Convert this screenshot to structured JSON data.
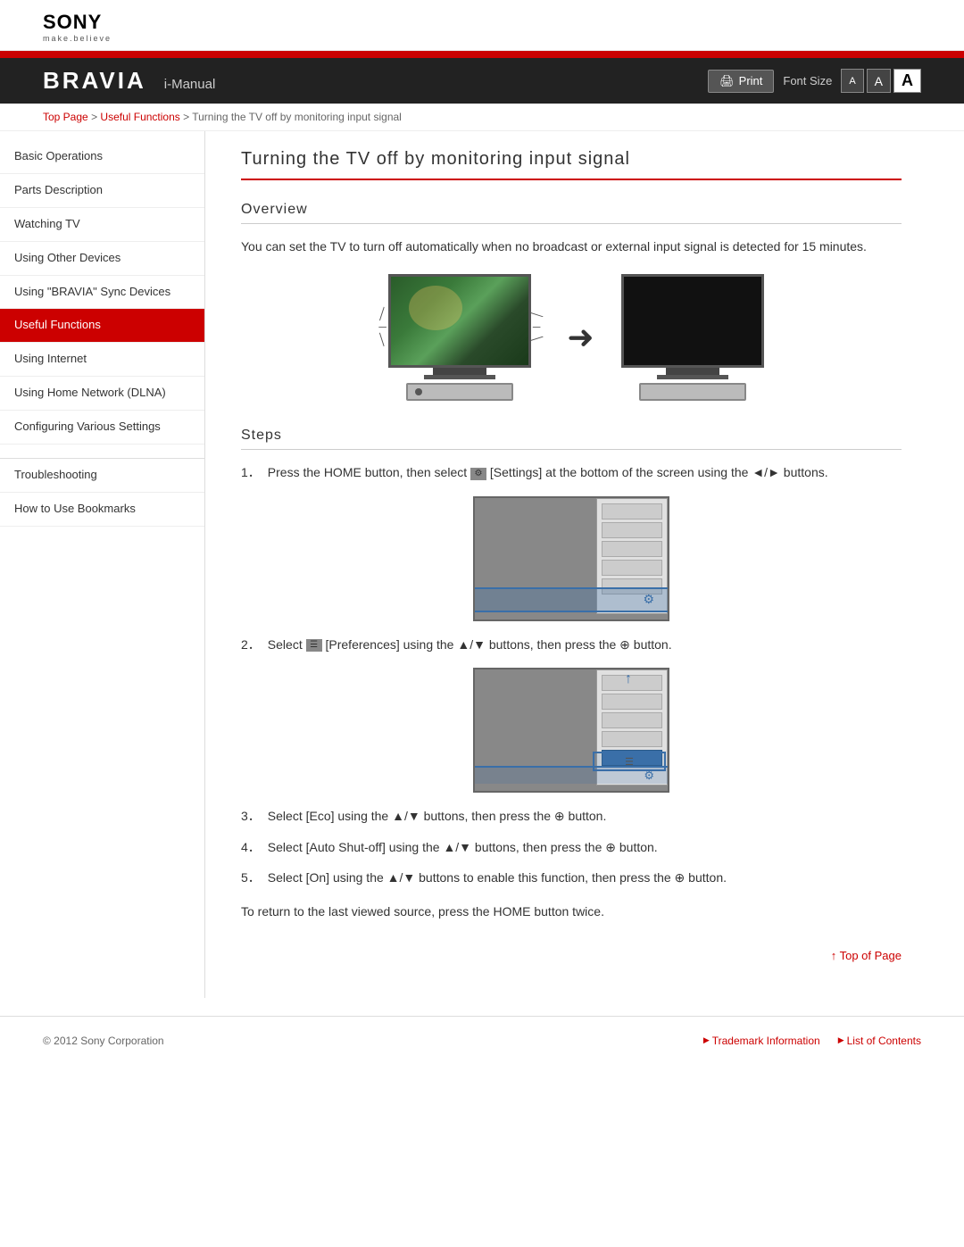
{
  "sony": {
    "logo": "SONY",
    "tagline": "make.believe"
  },
  "header": {
    "brand": "BRAVIA",
    "manual": "i-Manual",
    "print_label": "Print",
    "font_size_label": "Font Size",
    "font_small": "A",
    "font_medium": "A",
    "font_large": "A"
  },
  "breadcrumb": {
    "top_page": "Top Page",
    "separator1": " > ",
    "useful_functions": "Useful Functions",
    "separator2": " > ",
    "current": "Turning the TV off by monitoring input signal"
  },
  "sidebar": {
    "items": [
      {
        "label": "Basic Operations",
        "active": false
      },
      {
        "label": "Parts Description",
        "active": false
      },
      {
        "label": "Watching TV",
        "active": false
      },
      {
        "label": "Using Other Devices",
        "active": false
      },
      {
        "label": "Using \"BRAVIA\" Sync Devices",
        "active": false
      },
      {
        "label": "Useful Functions",
        "active": true
      },
      {
        "label": "Using Internet",
        "active": false
      },
      {
        "label": "Using Home Network (DLNA)",
        "active": false
      },
      {
        "label": "Configuring Various Settings",
        "active": false
      },
      {
        "label": "Troubleshooting",
        "active": false
      },
      {
        "label": "How to Use Bookmarks",
        "active": false
      }
    ]
  },
  "content": {
    "page_title": "Turning the TV off by monitoring input signal",
    "overview_heading": "Overview",
    "overview_text": "You can set the TV to turn off automatically when no broadcast or external input signal is detected for 15 minutes.",
    "steps_heading": "Steps",
    "steps": [
      {
        "num": "1",
        "text": "Press the HOME button, then select  [Settings] at the bottom of the screen using the ◄/► buttons."
      },
      {
        "num": "2",
        "text": "Select  [Preferences] using the ▲/▼ buttons, then press the ⊕ button."
      },
      {
        "num": "3",
        "text": "Select [Eco] using the ▲/▼ buttons, then press the ⊕ button."
      },
      {
        "num": "4",
        "text": "Select [Auto Shut-off] using the ▲/▼ buttons, then press the ⊕ button."
      },
      {
        "num": "5",
        "text": "Select [On] using the ▲/▼ buttons to enable this function, then press the ⊕ button."
      }
    ],
    "return_text": "To return to the last viewed source, press the HOME button twice.",
    "top_of_page": "Top of Page"
  },
  "footer": {
    "copyright": "© 2012 Sony Corporation",
    "trademark": "Trademark Information",
    "list_of_contents": "List of Contents"
  }
}
